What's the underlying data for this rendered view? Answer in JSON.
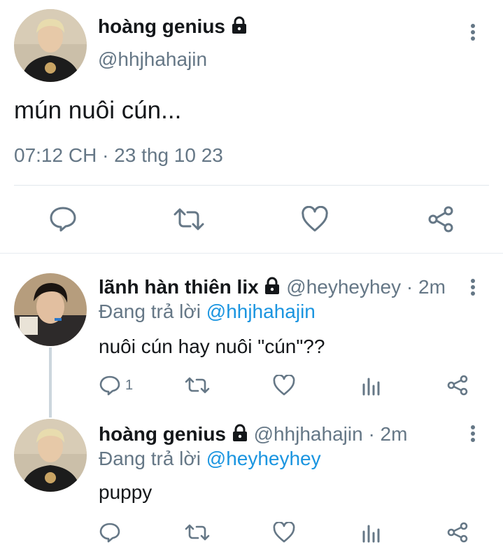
{
  "main_tweet": {
    "author_name": "hoàng genius",
    "author_handle": "@hhjhahajin",
    "text": "mún nuôi cún...",
    "timestamp": "07:12 CH · 23 thg 10 23"
  },
  "replies": [
    {
      "author_name": "lãnh hàn thiên lix",
      "author_handle": "@heyheyhey",
      "time": "· 2m",
      "replying_prefix": "Đang trả lời",
      "replying_to": "@hhjhahajin",
      "text": "nuôi cún hay nuôi \"cún\"??",
      "reply_count": "1"
    },
    {
      "author_name": "hoàng genius",
      "author_handle": "@hhjhahajin",
      "time": "· 2m",
      "replying_prefix": "Đang trả lời",
      "replying_to": "@heyheyhey",
      "text": "puppy",
      "reply_count": ""
    }
  ],
  "icons": {
    "lock": "lock-icon",
    "more": "more-vertical-icon",
    "reply": "reply-icon",
    "retweet": "retweet-icon",
    "like": "heart-icon",
    "analytics": "analytics-icon",
    "share": "share-icon"
  },
  "colors": {
    "text": "#14171a",
    "secondary": "#657786",
    "link": "#1b95e0",
    "divider": "#e1e8ed",
    "thread_line": "#ccd6dd"
  }
}
